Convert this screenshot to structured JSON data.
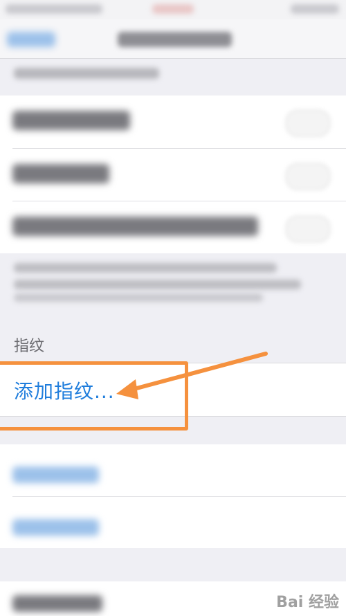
{
  "fingerprint_section": {
    "header": "指纹",
    "add_fingerprint": "添加指纹..."
  },
  "watermark": {
    "text": "Bai 经验"
  },
  "colors": {
    "link_blue": "#1f7ddc",
    "highlight_orange": "#f5913e",
    "group_background": "#efeff4"
  }
}
